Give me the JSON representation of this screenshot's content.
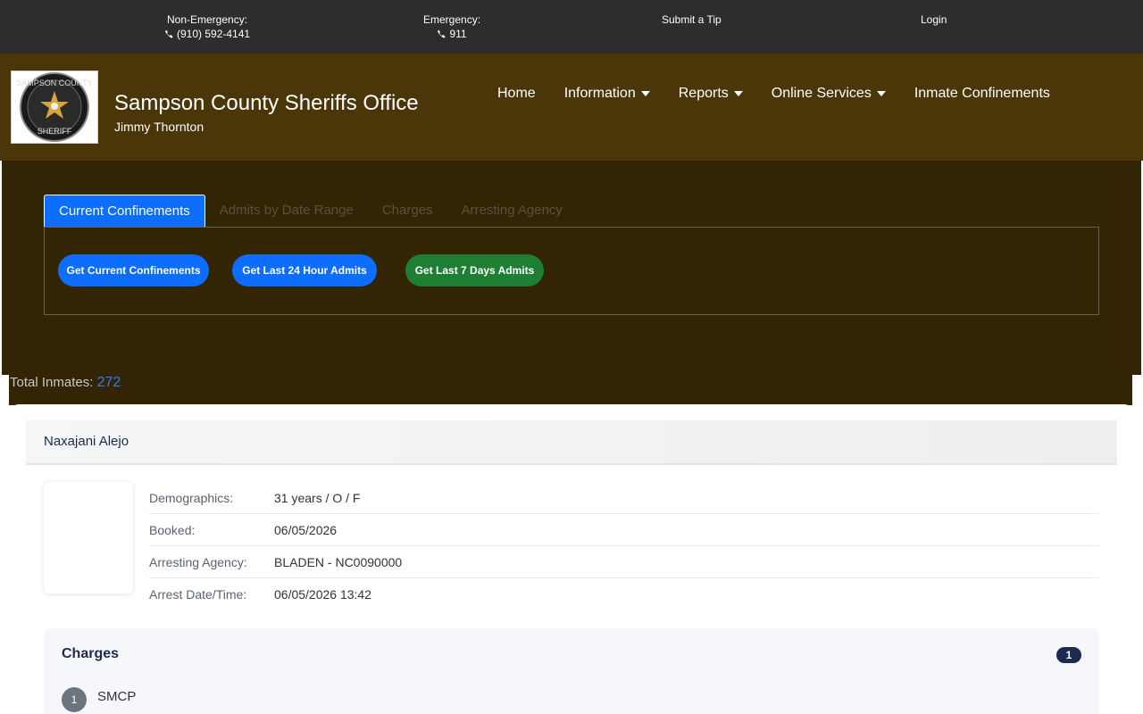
{
  "topbar": {
    "non_emergency_label": "Non-Emergency:",
    "non_emergency_phone": "(910) 592-4141",
    "emergency_label": "Emergency:",
    "emergency_phone": "911",
    "submit_tip": "Submit a Tip",
    "login": "Login"
  },
  "header": {
    "title": "Sampson County Sheriffs Office",
    "subtitle": "Jimmy Thornton",
    "logo_text_top": "SAMPSON COUNTY",
    "logo_text_bottom": "SHERIFF"
  },
  "nav": {
    "items": [
      {
        "label": "Home",
        "dropdown": false
      },
      {
        "label": "Information",
        "dropdown": true
      },
      {
        "label": "Reports",
        "dropdown": true
      },
      {
        "label": "Online Services",
        "dropdown": true
      },
      {
        "label": "Inmate Confinements",
        "dropdown": false
      }
    ]
  },
  "tabs": {
    "items": [
      "Current Confinements",
      "Admits by Date Range",
      "Charges",
      "Arresting Agency"
    ],
    "active": "Current Confinements"
  },
  "buttons": {
    "current": "Get Current Confinements",
    "last24": "Get Last 24 Hour Admits",
    "last7": "Get Last 7 Days Admits"
  },
  "summary": {
    "total_label": "Total Inmates:",
    "total_count": "272"
  },
  "inmate": {
    "name": "Naxajani Alejo",
    "fields": [
      {
        "label": "Demographics:",
        "value": "31 years / O / F"
      },
      {
        "label": "Booked:",
        "value": "06/05/2026"
      },
      {
        "label": "Arresting Agency:",
        "value": "BLADEN - NC0090000"
      },
      {
        "label": "Arrest Date/Time:",
        "value": "06/05/2026 13:42"
      }
    ],
    "charges_title": "Charges",
    "charges_count": "1",
    "charges": [
      {
        "num": "1",
        "text": "SMCP"
      }
    ]
  },
  "colors": {
    "topbar": "#2d2d2d",
    "header": "#4a3608",
    "panel": "#332404",
    "primary": "#0d6efd",
    "success": "#1e7e34",
    "navy": "#1b2a4e"
  }
}
